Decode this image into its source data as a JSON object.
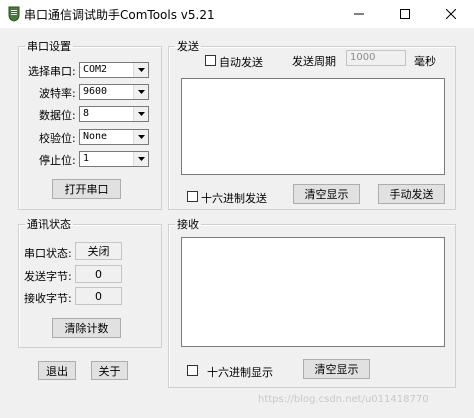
{
  "window": {
    "title": "串口通信调试助手ComTools v5.21"
  },
  "serial_settings": {
    "legend": "串口设置",
    "port_label": "选择串口:",
    "port_value": "COM2",
    "baud_label": "波特率:",
    "baud_value": "9600",
    "databits_label": "数据位:",
    "databits_value": "8",
    "parity_label": "校验位:",
    "parity_value": "None",
    "stopbits_label": "停止位:",
    "stopbits_value": "1",
    "open_button": "打开串口"
  },
  "comm_status": {
    "legend": "通讯状态",
    "port_status_label": "串口状态:",
    "port_status_value": "关闭",
    "sent_label": "发送字节:",
    "sent_value": "0",
    "received_label": "接收字节:",
    "received_value": "0",
    "clear_counts_button": "清除计数"
  },
  "bottom_buttons": {
    "exit": "退出",
    "about": "关于"
  },
  "send": {
    "legend": "发送",
    "auto_send_label": "自动发送",
    "period_label": "发送周期",
    "period_value": "1000",
    "period_unit": "毫秒",
    "hex_send_label": "十六进制发送",
    "clear_button": "清空显示",
    "manual_send_button": "手动发送"
  },
  "receive": {
    "legend": "接收",
    "hex_display_label": "十六进制显示",
    "clear_button": "清空显示"
  },
  "watermark": "https://blog.csdn.net/u011418770"
}
